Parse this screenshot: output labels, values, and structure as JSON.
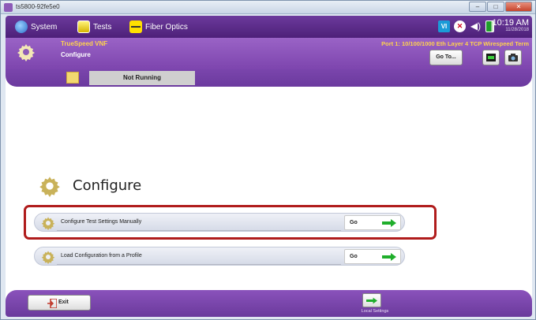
{
  "window": {
    "title": "ts5800-92fe5e0",
    "controls": [
      "minimize-icon",
      "maximize-icon",
      "close-icon"
    ]
  },
  "navbar": {
    "items": [
      {
        "label": "System",
        "icon": "system-icon"
      },
      {
        "label": "Tests",
        "icon": "tests-icon"
      },
      {
        "label": "Fiber Optics",
        "icon": "fiber-optics-icon"
      }
    ],
    "status_icons": [
      "vi-icon",
      "alarm-icon",
      "speaker-icon",
      "battery-icon"
    ],
    "vi_text": "VI",
    "time": "10:19 AM",
    "date": "11/28/2018"
  },
  "header": {
    "app_name": "TrueSpeed VNF",
    "page_name": "Configure",
    "port": "Port 1: 10/100/1000 Eth Layer 4 TCP Wirespeed Term",
    "goto_label": "Go To..."
  },
  "strip": {
    "status": "Not Running"
  },
  "main": {
    "title": "Configure",
    "rows": [
      {
        "label": "Configure Test Settings Manually",
        "go": "Go"
      },
      {
        "label": "Load Configuration from a Profile",
        "go": "Go"
      }
    ]
  },
  "footer": {
    "exit_label": "Exit",
    "local_settings_label": "Local Settings"
  },
  "colors": {
    "nav_purple": "#4d2079",
    "header_purple": "#8a52bb",
    "highlight_red": "#b01c1c",
    "arrow_green": "#1fae2b",
    "accent_yellow": "#ffd34d"
  }
}
